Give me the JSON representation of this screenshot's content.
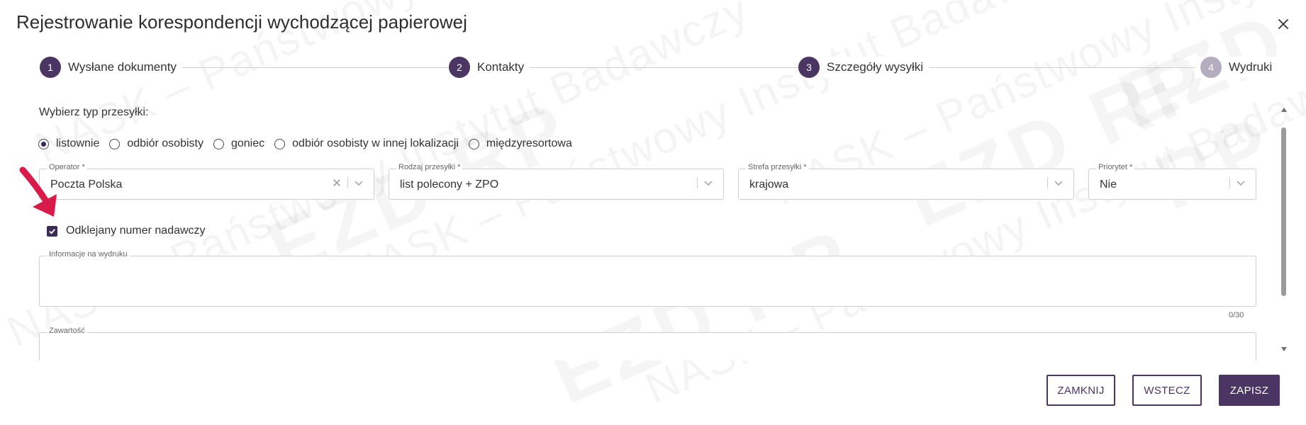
{
  "dialog": {
    "title": "Rejestrowanie korespondencji wychodzącej papierowej",
    "close_icon": "close-icon"
  },
  "watermark": {
    "text": "NASK – Państwowy Instytut Badawczy",
    "logo": "EZD RP"
  },
  "stepper": {
    "steps": [
      {
        "number": "1",
        "label": "Wysłane dokumenty",
        "active": true
      },
      {
        "number": "2",
        "label": "Kontakty",
        "active": true
      },
      {
        "number": "3",
        "label": "Szczegóły wysyłki",
        "active": true
      },
      {
        "number": "4",
        "label": "Wydruki",
        "active": false
      }
    ]
  },
  "shipment_type": {
    "label": "Wybierz typ przesyłki:",
    "options": [
      {
        "label": "listownie",
        "selected": true
      },
      {
        "label": "odbiór osobisty",
        "selected": false
      },
      {
        "label": "goniec",
        "selected": false
      },
      {
        "label": "odbiór osobisty w innej lokalizacji",
        "selected": false
      },
      {
        "label": "międzyresortowa",
        "selected": false
      }
    ]
  },
  "fields": {
    "operator": {
      "label": "Operator *",
      "value": "Poczta Polska",
      "clear_icon": "clear-icon"
    },
    "rodzaj": {
      "label": "Rodzaj przesyłki *",
      "value": "list polecony + ZPO"
    },
    "strefa": {
      "label": "Strefa przesyłki *",
      "value": "krajowa"
    },
    "priorytet": {
      "label": "Priorytet *",
      "value": "Nie"
    }
  },
  "checkbox": {
    "label": "Odklejany numer nadawczy",
    "checked": true
  },
  "info_textarea": {
    "label": "Informacje na wydruku",
    "value": "",
    "counter": "0/30"
  },
  "content_textarea": {
    "label": "Zawartość",
    "value": ""
  },
  "buttons": {
    "close": "ZAMKNIJ",
    "back": "WSTECZ",
    "save": "ZAPISZ"
  },
  "colors": {
    "accent": "#4a3563",
    "inactive_step": "#b3adbf",
    "annotation_arrow": "#d81b4a"
  }
}
